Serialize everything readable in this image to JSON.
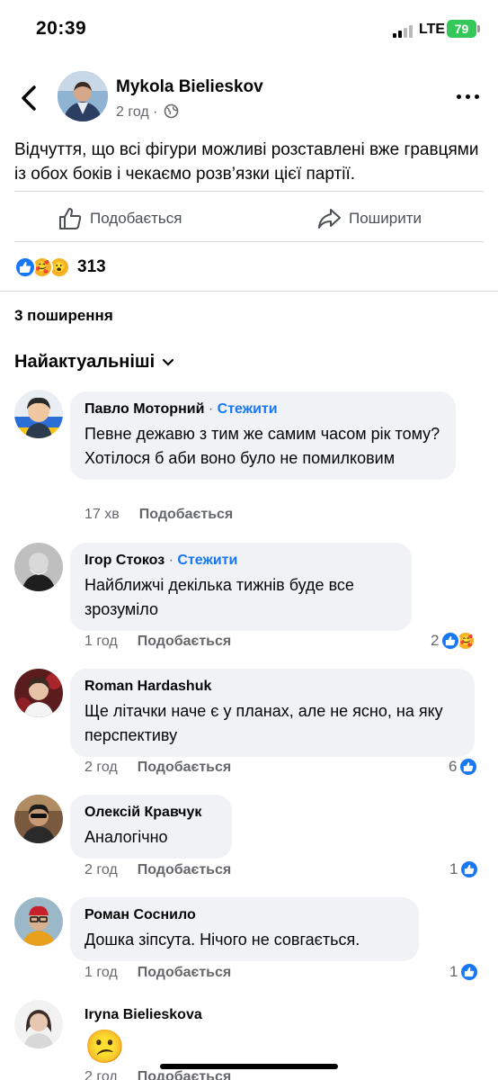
{
  "status_bar": {
    "time": "20:39",
    "network": "LTE",
    "battery": "79"
  },
  "post": {
    "author": "Mykola Bielieskov",
    "time": "2 год",
    "privacy_icon": "globe-icon",
    "text": "Відчуття, що всі фігури можливі розставлені вже гравцями із обох боків і чекаємо розв’язки цієї партії.",
    "like_label": "Подобається",
    "share_label": "Поширити",
    "reaction_count": "313",
    "reactions": [
      "like",
      "care",
      "wow"
    ],
    "shares": "3 поширення",
    "sort_label": "Найактуальніші"
  },
  "comments": [
    {
      "author": "Павло Моторний",
      "follow": "Стежити",
      "text": "Певне дежавю з тим же самим часом рік тому? Хотілося б аби воно було не помилковим",
      "time": "17 хв",
      "like_label": "Подобається",
      "reaction_count": ""
    },
    {
      "author": "Ігор Стокоз",
      "follow": "Стежити",
      "text": "Найближчі декілька тижнів буде все зрозуміло",
      "time": "1 год",
      "like_label": "Подобається",
      "reaction_count": "2"
    },
    {
      "author": "Roman Hardashuk",
      "follow": "",
      "text": "Ще літачки наче є у планах, але не ясно, на яку перспективу",
      "time": "2 год",
      "like_label": "Подобається",
      "reaction_count": "6"
    },
    {
      "author": "Олексій Кравчук",
      "follow": "",
      "text": "Аналогічно",
      "time": "2 год",
      "like_label": "Подобається",
      "reaction_count": "1"
    },
    {
      "author": "Роман Соснило",
      "follow": "",
      "text": "Дошка зіпсута. Нічого не совгається.",
      "time": "1 год",
      "like_label": "Подобається",
      "reaction_count": "1"
    },
    {
      "author": "Iryna Bielieskova",
      "follow": "",
      "text": "😕",
      "time": "2 год",
      "like_label": "Подобається",
      "reaction_count": ""
    }
  ],
  "follow_separator": "·"
}
